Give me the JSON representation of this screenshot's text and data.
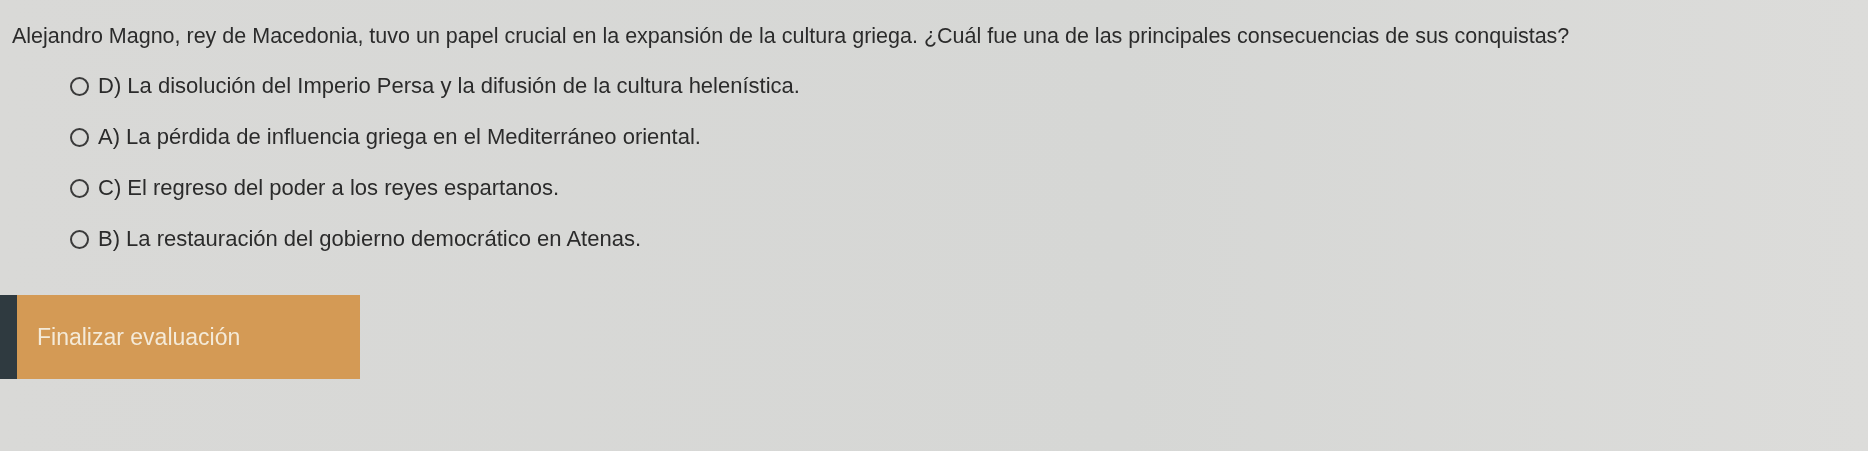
{
  "question": "Alejandro Magno, rey de Macedonia, tuvo un papel crucial en la expansión de la cultura griega. ¿Cuál fue una de las principales consecuencias de sus conquistas?",
  "options": [
    {
      "label": "D) La disolución del Imperio Persa y la difusión de la cultura helenística.",
      "selected": false
    },
    {
      "label": "A) La pérdida de influencia griega en el Mediterráneo oriental.",
      "selected": false
    },
    {
      "label": "C) El regreso del poder a los reyes espartanos.",
      "selected": false
    },
    {
      "label": "B) La restauración del gobierno democrático en Atenas.",
      "selected": false
    }
  ],
  "submit_button": "Finalizar evaluación"
}
